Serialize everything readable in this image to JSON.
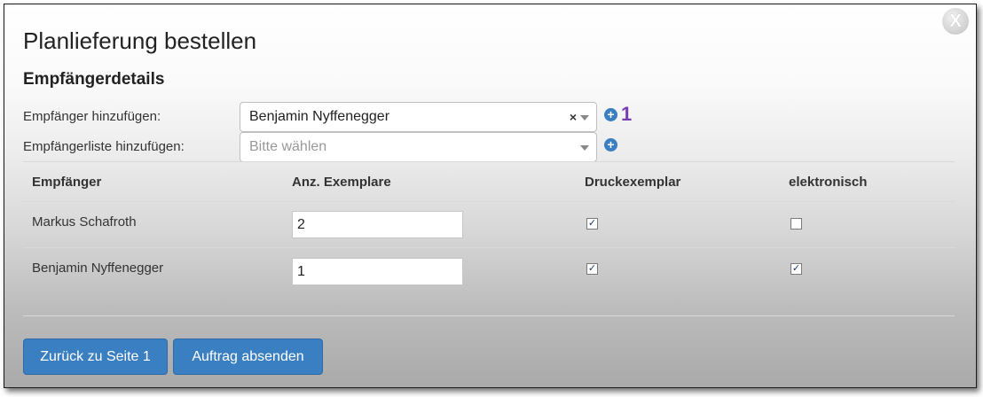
{
  "dialog": {
    "title": "Planlieferung bestellen",
    "close_label": "X",
    "section_title": "Empfängerdetails"
  },
  "add_recipient": {
    "label": "Empfänger hinzufügen:",
    "selected_value": "Benjamin Nyffenegger",
    "clear_symbol": "×",
    "count": "1"
  },
  "add_recipient_list": {
    "label": "Empfängerliste hinzufügen:",
    "placeholder": "Bitte wählen"
  },
  "table": {
    "headers": [
      "Empfänger",
      "Anz. Exemplare",
      "Druckexemplar",
      "elektronisch"
    ],
    "rows": [
      {
        "name": "Markus Schafroth",
        "copies": "2",
        "print": true,
        "electronic": false
      },
      {
        "name": "Benjamin Nyffenegger",
        "copies": "1",
        "print": true,
        "electronic": true
      }
    ]
  },
  "buttons": {
    "back": "Zurück zu Seite 1",
    "submit": "Auftrag absenden"
  },
  "colors": {
    "primary_button": "#3a7fc1",
    "count_badge": "#7a3db0"
  }
}
